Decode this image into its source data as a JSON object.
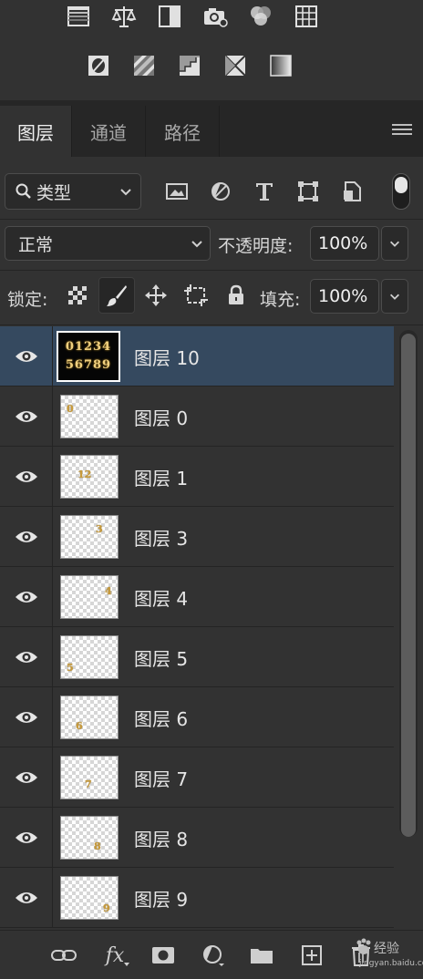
{
  "adjustments": {
    "row1": [
      "levels-icon",
      "balance-icon",
      "exposure-icon",
      "camera-filter-icon",
      "channel-mixer-icon",
      "color-lookup-icon"
    ],
    "row2": [
      "invert-icon",
      "posterize-icon",
      "threshold-icon",
      "selective-color-icon",
      "gradient-map-icon"
    ]
  },
  "tabs": [
    {
      "label": "图层",
      "active": true
    },
    {
      "label": "通道",
      "active": false
    },
    {
      "label": "路径",
      "active": false
    }
  ],
  "filter": {
    "kind_label": "类型"
  },
  "blend": {
    "mode": "正常",
    "opacity_label": "不透明度:",
    "opacity_value": "100%",
    "lock_label": "锁定:",
    "fill_label": "填充:",
    "fill_value": "100%"
  },
  "layers": [
    {
      "name": "图层 10",
      "selected": true,
      "thumb": "01234\n56789"
    },
    {
      "name": "图层 0",
      "selected": false,
      "digit": "0"
    },
    {
      "name": "图层 1",
      "selected": false,
      "digit": "12"
    },
    {
      "name": "图层 3",
      "selected": false,
      "digit": "3"
    },
    {
      "name": "图层 4",
      "selected": false,
      "digit": "4"
    },
    {
      "name": "图层 5",
      "selected": false,
      "digit": "5"
    },
    {
      "name": "图层 6",
      "selected": false,
      "digit": "6"
    },
    {
      "name": "图层 7",
      "selected": false,
      "digit": "7"
    },
    {
      "name": "图层 8",
      "selected": false,
      "digit": "8"
    },
    {
      "name": "图层 9",
      "selected": false,
      "digit": "9"
    }
  ],
  "thumb10": {
    "line1": "01234",
    "line2": "56789"
  },
  "bottom_bar": {
    "fx_label": "fx"
  },
  "watermark": {
    "text": "经验",
    "url": "jingyan.baidu.com"
  },
  "colors": {
    "panel": "#323232",
    "selected": "#35495f",
    "dark": "#262626"
  }
}
